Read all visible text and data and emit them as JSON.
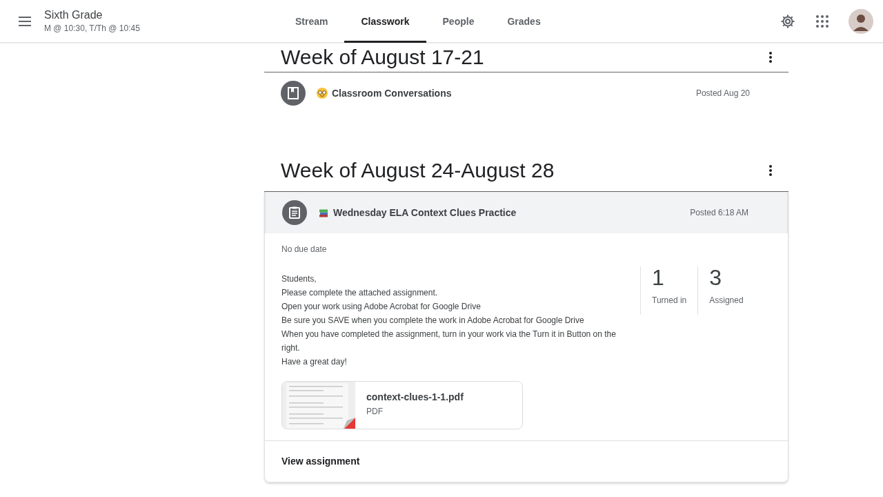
{
  "header": {
    "class_name": "Sixth Grade",
    "schedule": "M @ 10:30, T/Th @ 10:45",
    "tabs": [
      {
        "label": "Stream",
        "selected": false
      },
      {
        "label": "Classwork",
        "selected": true
      },
      {
        "label": "People",
        "selected": false
      },
      {
        "label": "Grades",
        "selected": false
      }
    ]
  },
  "topics": [
    {
      "title": "Week of August 17-21",
      "items": [
        {
          "kind": "material",
          "title": "Classroom Conversations",
          "posted": "Posted Aug 20",
          "expanded": false
        }
      ]
    },
    {
      "title": "Week of August 24-August 28",
      "items": [
        {
          "kind": "assignment",
          "title": "Wednesday ELA Context Clues Practice",
          "posted": "Posted 6:18 AM",
          "expanded": true,
          "due": "No due date",
          "instructions": [
            "Students,",
            "Please complete the attached assignment.",
            "Open your work using Adobe Acrobat for Google Drive",
            "Be sure you SAVE when you complete the work in Adobe Acrobat for Google Drive",
            "When you have completed the assignment, turn in your work via the Turn it in Button on the right.",
            "Have a great day!"
          ],
          "stats": [
            {
              "count": "1",
              "label": "Turned in"
            },
            {
              "count": "3",
              "label": "Assigned"
            }
          ],
          "attachment": {
            "name": "context-clues-1-1.pdf",
            "type": "PDF"
          },
          "link": "View assignment"
        }
      ]
    }
  ]
}
